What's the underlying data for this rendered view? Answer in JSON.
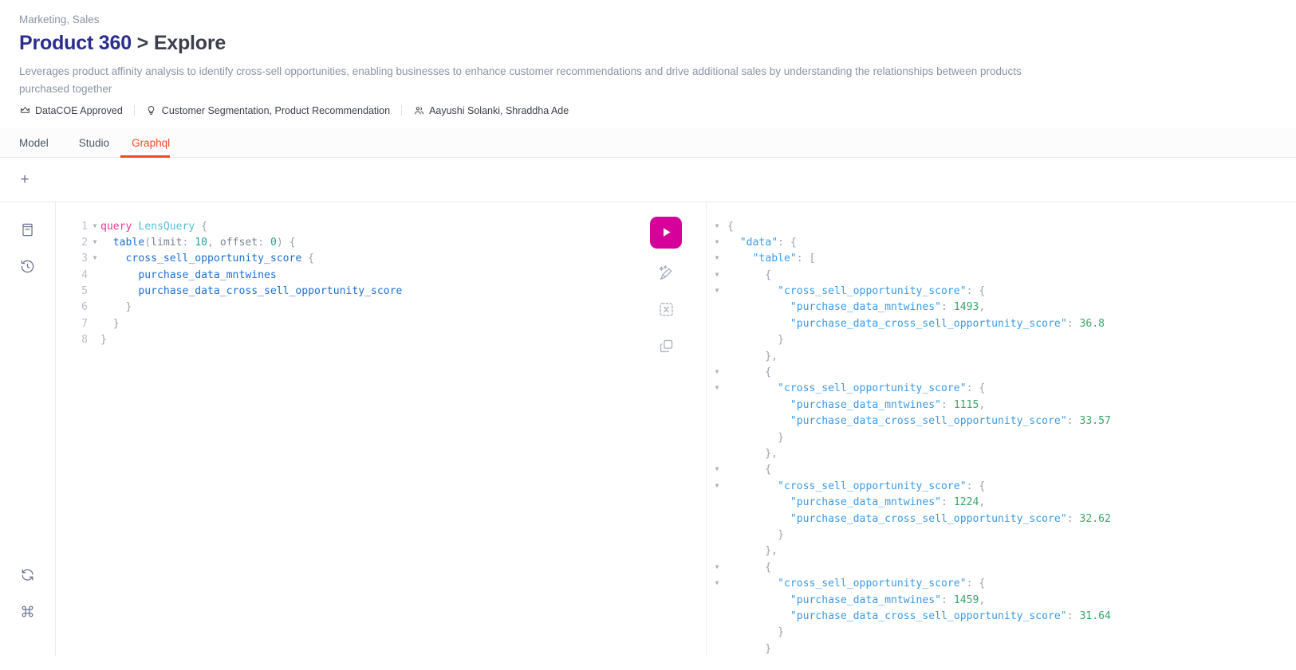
{
  "header": {
    "breadcrumb": "Marketing, Sales",
    "title_lead": "Product 360",
    "title_sep": " > ",
    "title_trail": "Explore",
    "description": "Leverages product affinity analysis to identify cross‑sell opportunities, enabling businesses to enhance customer recommendations and drive additional sales by understanding the relationships between products purchased together",
    "meta": [
      {
        "icon": "crown-icon",
        "label": "DataCOE Approved"
      },
      {
        "icon": "bulb-icon",
        "label": "Customer Segmentation, Product Recommendation"
      },
      {
        "icon": "people-icon",
        "label": "Aayushi Solanki, Shraddha Ade"
      }
    ]
  },
  "tabs": [
    {
      "label": "Model",
      "active": false
    },
    {
      "label": "Studio",
      "active": false
    },
    {
      "label": "Graphql",
      "active": true
    }
  ],
  "tabstrip": {
    "add_label": "+"
  },
  "rail": {
    "top_icons": [
      {
        "name": "docs-icon",
        "title": "Documentation Explorer"
      },
      {
        "name": "history-icon",
        "title": "History"
      }
    ],
    "bottom_icons": [
      {
        "name": "refresh-icon",
        "title": "Re-fetch GraphQL schema"
      },
      {
        "name": "command-icon",
        "title": "Open short keys dialog"
      }
    ]
  },
  "actions": {
    "execute": {
      "name": "execute-query-button",
      "label": "Execute query"
    },
    "items": [
      {
        "name": "prettify-icon",
        "label": "Prettify query"
      },
      {
        "name": "merge-icon",
        "label": "Merge fragments into query"
      },
      {
        "name": "copy-icon",
        "label": "Copy query"
      }
    ]
  },
  "editor": {
    "lines": [
      {
        "n": "1",
        "fold": true,
        "tokens": [
          {
            "t": "query ",
            "c": "kw"
          },
          {
            "t": "LensQuery",
            "c": "opn"
          },
          {
            "t": " {",
            "c": "pun"
          }
        ]
      },
      {
        "n": "2",
        "fold": true,
        "tokens": [
          {
            "t": "  ",
            "c": "pun"
          },
          {
            "t": "table",
            "c": "fld"
          },
          {
            "t": "(",
            "c": "pun"
          },
          {
            "t": "limit",
            "c": "arg"
          },
          {
            "t": ": ",
            "c": "pun"
          },
          {
            "t": "10",
            "c": "num"
          },
          {
            "t": ", ",
            "c": "pun"
          },
          {
            "t": "offset",
            "c": "arg"
          },
          {
            "t": ": ",
            "c": "pun"
          },
          {
            "t": "0",
            "c": "num"
          },
          {
            "t": ") {",
            "c": "pun"
          }
        ]
      },
      {
        "n": "3",
        "fold": true,
        "tokens": [
          {
            "t": "    ",
            "c": "pun"
          },
          {
            "t": "cross_sell_opportunity_score",
            "c": "fld"
          },
          {
            "t": " {",
            "c": "pun"
          }
        ]
      },
      {
        "n": "4",
        "fold": false,
        "tokens": [
          {
            "t": "      ",
            "c": "pun"
          },
          {
            "t": "purchase_data_mntwines",
            "c": "fld"
          }
        ]
      },
      {
        "n": "5",
        "fold": false,
        "tokens": [
          {
            "t": "      ",
            "c": "pun"
          },
          {
            "t": "purchase_data_cross_sell_opportunity_score",
            "c": "fld"
          }
        ]
      },
      {
        "n": "6",
        "fold": false,
        "tokens": [
          {
            "t": "    }",
            "c": "pun"
          }
        ]
      },
      {
        "n": "7",
        "fold": false,
        "tokens": [
          {
            "t": "  }",
            "c": "pun"
          }
        ]
      },
      {
        "n": "8",
        "fold": false,
        "tokens": [
          {
            "t": "}",
            "c": "pun"
          }
        ]
      }
    ]
  },
  "result": {
    "lines": [
      {
        "fold": true,
        "tokens": [
          {
            "t": "{",
            "c": "jp"
          }
        ]
      },
      {
        "fold": true,
        "tokens": [
          {
            "t": "  ",
            "c": "jp"
          },
          {
            "t": "\"data\"",
            "c": "jk"
          },
          {
            "t": ": {",
            "c": "jp"
          }
        ]
      },
      {
        "fold": true,
        "tokens": [
          {
            "t": "    ",
            "c": "jp"
          },
          {
            "t": "\"table\"",
            "c": "jk"
          },
          {
            "t": ": [",
            "c": "jp"
          }
        ]
      },
      {
        "fold": true,
        "tokens": [
          {
            "t": "      {",
            "c": "jp"
          }
        ]
      },
      {
        "fold": true,
        "tokens": [
          {
            "t": "        ",
            "c": "jp"
          },
          {
            "t": "\"cross_sell_opportunity_score\"",
            "c": "jk"
          },
          {
            "t": ": {",
            "c": "jp"
          }
        ]
      },
      {
        "fold": false,
        "tokens": [
          {
            "t": "          ",
            "c": "jp"
          },
          {
            "t": "\"purchase_data_mntwines\"",
            "c": "jk"
          },
          {
            "t": ": ",
            "c": "jp"
          },
          {
            "t": "1493",
            "c": "jn"
          },
          {
            "t": ",",
            "c": "jp"
          }
        ]
      },
      {
        "fold": false,
        "tokens": [
          {
            "t": "          ",
            "c": "jp"
          },
          {
            "t": "\"purchase_data_cross_sell_opportunity_score\"",
            "c": "jk"
          },
          {
            "t": ": ",
            "c": "jp"
          },
          {
            "t": "36.8",
            "c": "jn"
          }
        ]
      },
      {
        "fold": false,
        "tokens": [
          {
            "t": "        }",
            "c": "jp"
          }
        ]
      },
      {
        "fold": false,
        "tokens": [
          {
            "t": "      },",
            "c": "jp"
          }
        ]
      },
      {
        "fold": true,
        "tokens": [
          {
            "t": "      {",
            "c": "jp"
          }
        ]
      },
      {
        "fold": true,
        "tokens": [
          {
            "t": "        ",
            "c": "jp"
          },
          {
            "t": "\"cross_sell_opportunity_score\"",
            "c": "jk"
          },
          {
            "t": ": {",
            "c": "jp"
          }
        ]
      },
      {
        "fold": false,
        "tokens": [
          {
            "t": "          ",
            "c": "jp"
          },
          {
            "t": "\"purchase_data_mntwines\"",
            "c": "jk"
          },
          {
            "t": ": ",
            "c": "jp"
          },
          {
            "t": "1115",
            "c": "jn"
          },
          {
            "t": ",",
            "c": "jp"
          }
        ]
      },
      {
        "fold": false,
        "tokens": [
          {
            "t": "          ",
            "c": "jp"
          },
          {
            "t": "\"purchase_data_cross_sell_opportunity_score\"",
            "c": "jk"
          },
          {
            "t": ": ",
            "c": "jp"
          },
          {
            "t": "33.57",
            "c": "jn"
          }
        ]
      },
      {
        "fold": false,
        "tokens": [
          {
            "t": "        }",
            "c": "jp"
          }
        ]
      },
      {
        "fold": false,
        "tokens": [
          {
            "t": "      },",
            "c": "jp"
          }
        ]
      },
      {
        "fold": true,
        "tokens": [
          {
            "t": "      {",
            "c": "jp"
          }
        ]
      },
      {
        "fold": true,
        "tokens": [
          {
            "t": "        ",
            "c": "jp"
          },
          {
            "t": "\"cross_sell_opportunity_score\"",
            "c": "jk"
          },
          {
            "t": ": {",
            "c": "jp"
          }
        ]
      },
      {
        "fold": false,
        "tokens": [
          {
            "t": "          ",
            "c": "jp"
          },
          {
            "t": "\"purchase_data_mntwines\"",
            "c": "jk"
          },
          {
            "t": ": ",
            "c": "jp"
          },
          {
            "t": "1224",
            "c": "jn"
          },
          {
            "t": ",",
            "c": "jp"
          }
        ]
      },
      {
        "fold": false,
        "tokens": [
          {
            "t": "          ",
            "c": "jp"
          },
          {
            "t": "\"purchase_data_cross_sell_opportunity_score\"",
            "c": "jk"
          },
          {
            "t": ": ",
            "c": "jp"
          },
          {
            "t": "32.62",
            "c": "jn"
          }
        ]
      },
      {
        "fold": false,
        "tokens": [
          {
            "t": "        }",
            "c": "jp"
          }
        ]
      },
      {
        "fold": false,
        "tokens": [
          {
            "t": "      },",
            "c": "jp"
          }
        ]
      },
      {
        "fold": true,
        "tokens": [
          {
            "t": "      {",
            "c": "jp"
          }
        ]
      },
      {
        "fold": true,
        "tokens": [
          {
            "t": "        ",
            "c": "jp"
          },
          {
            "t": "\"cross_sell_opportunity_score\"",
            "c": "jk"
          },
          {
            "t": ": {",
            "c": "jp"
          }
        ]
      },
      {
        "fold": false,
        "tokens": [
          {
            "t": "          ",
            "c": "jp"
          },
          {
            "t": "\"purchase_data_mntwines\"",
            "c": "jk"
          },
          {
            "t": ": ",
            "c": "jp"
          },
          {
            "t": "1459",
            "c": "jn"
          },
          {
            "t": ",",
            "c": "jp"
          }
        ]
      },
      {
        "fold": false,
        "tokens": [
          {
            "t": "          ",
            "c": "jp"
          },
          {
            "t": "\"purchase_data_cross_sell_opportunity_score\"",
            "c": "jk"
          },
          {
            "t": ": ",
            "c": "jp"
          },
          {
            "t": "31.64",
            "c": "jn"
          }
        ]
      },
      {
        "fold": false,
        "tokens": [
          {
            "t": "        }",
            "c": "jp"
          }
        ]
      },
      {
        "fold": false,
        "tokens": [
          {
            "t": "      }",
            "c": "jp"
          }
        ]
      }
    ],
    "rows": [
      {
        "purchase_data_mntwines": 1493,
        "purchase_data_cross_sell_opportunity_score": 36.8
      },
      {
        "purchase_data_mntwines": 1115,
        "purchase_data_cross_sell_opportunity_score": 33.57
      },
      {
        "purchase_data_mntwines": 1224,
        "purchase_data_cross_sell_opportunity_score": 32.62
      },
      {
        "purchase_data_mntwines": 1459,
        "purchase_data_cross_sell_opportunity_score": 31.64
      }
    ]
  },
  "colors": {
    "accent_tab": "#f04a23",
    "title_lead": "#2a2d8f",
    "execute_button": "#d6009a",
    "json_key": "#3c9ae8",
    "json_number": "#3aa76d",
    "gql_keyword": "#e63995",
    "gql_field": "#1f6fd0"
  }
}
